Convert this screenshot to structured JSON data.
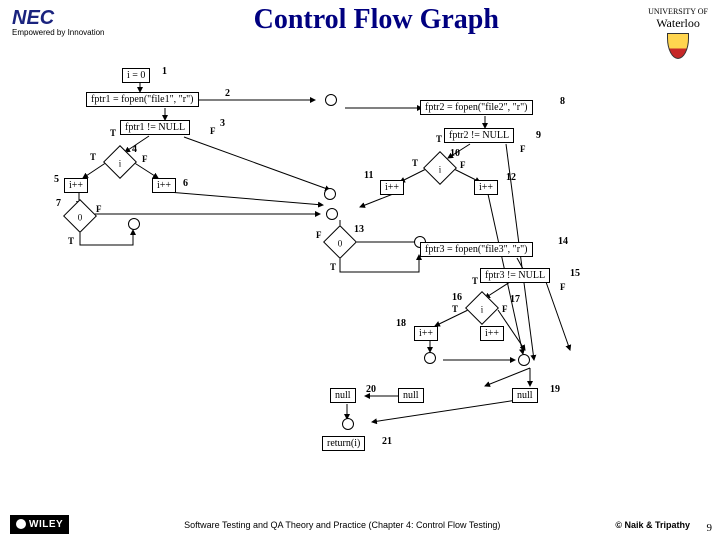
{
  "header": {
    "nec": "NEC",
    "nec_sub": "Empowered by Innovation",
    "title": "Control Flow Graph",
    "waterloo_uni": "UNIVERSITY OF",
    "waterloo_name": "Waterloo"
  },
  "nodes": {
    "n1": "i = 0",
    "n2": "fptr1 = fopen(\"file1\", \"r\")",
    "n3": "fptr1 != NULL",
    "n4": "i",
    "n5": "i++",
    "n6": "i++",
    "n7": "0",
    "n8": "fptr2 = fopen(\"file2\", \"r\")",
    "n9": "fptr2 != NULL",
    "n10": "i",
    "n11": "i++",
    "n12": "i++",
    "n13": "0",
    "n14": "fptr3 = fopen(\"file3\", \"r\")",
    "n15": "fptr3 != NULL",
    "n16": "i",
    "n17": "i++",
    "n18": "i++",
    "n19": "null",
    "n20": "null",
    "n21": "return(i)"
  },
  "labels": {
    "T": "T",
    "F": "F"
  },
  "footer": {
    "wiley": "WILEY",
    "text": "Software Testing and QA Theory and Practice (Chapter 4: Control Flow Testing)",
    "copyright": "© Naik & Tripathy",
    "page": "9"
  }
}
